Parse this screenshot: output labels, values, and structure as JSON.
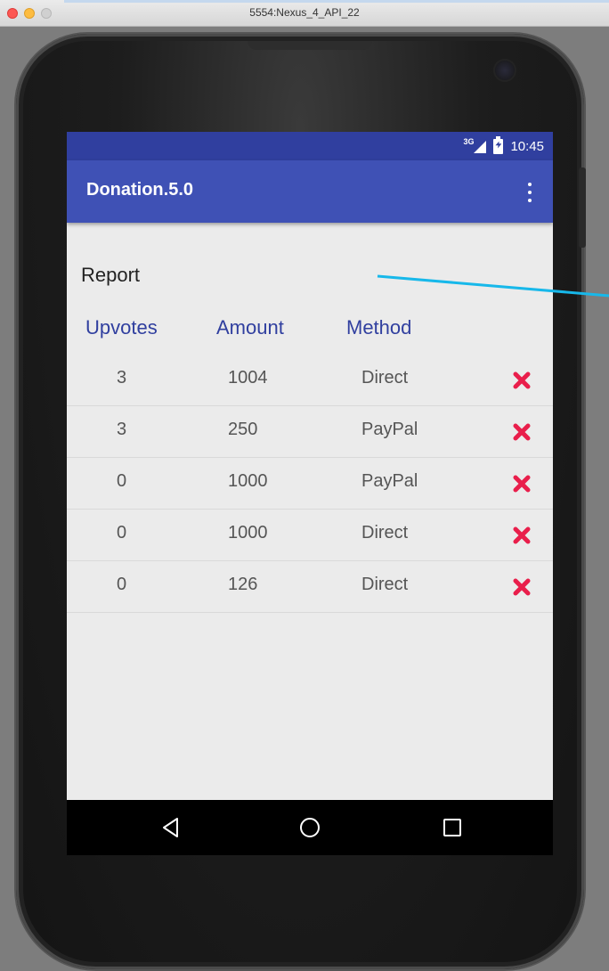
{
  "window": {
    "title": "5554:Nexus_4_API_22"
  },
  "status_bar": {
    "network": "3G",
    "time": "10:45"
  },
  "app_bar": {
    "title": "Donation.5.0",
    "menu_icon": "overflow-menu-icon"
  },
  "report": {
    "title": "Report",
    "headers": [
      "Upvotes",
      "Amount",
      "Method"
    ],
    "rows": [
      {
        "upvotes": "3",
        "amount": "1004",
        "method": "Direct"
      },
      {
        "upvotes": "3",
        "amount": "250",
        "method": "PayPal"
      },
      {
        "upvotes": "0",
        "amount": "1000",
        "method": "PayPal"
      },
      {
        "upvotes": "0",
        "amount": "1000",
        "method": "Direct"
      },
      {
        "upvotes": "0",
        "amount": "126",
        "method": "Direct"
      }
    ],
    "delete_icon": "delete-x-icon"
  },
  "nav_bar": {
    "icons": [
      "back-icon",
      "home-icon",
      "recents-icon"
    ]
  },
  "colors": {
    "status_bar": "#303f9f",
    "app_bar": "#3f51b5",
    "header_text": "#303f9f",
    "delete": "#e91e4b",
    "pointer_line": "#17b8ea"
  }
}
